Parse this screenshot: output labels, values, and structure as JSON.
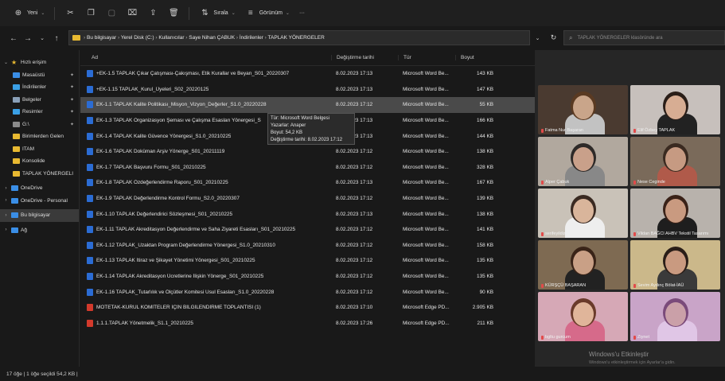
{
  "toolbar": {
    "new_label": "Yeni",
    "sort_label": "Sırala",
    "view_label": "Görünüm",
    "more_label": "···"
  },
  "address": {
    "breadcrumb": [
      "Bu bilgisayar",
      "Yerel Disk (C:)",
      "Kullanıcılar",
      "Saye Nihan ÇABUK",
      "İndirilenler",
      "TAPLAK YÖNERGELER"
    ],
    "search_placeholder": "TAPLAK YÖNERGELER klasöründe ara"
  },
  "sidebar": {
    "items": [
      {
        "label": "Hızlı erişim",
        "icon": "star-icon",
        "color": "#e8b931",
        "pinned": false
      },
      {
        "label": "Masaüstü",
        "icon": "desktop-icon",
        "color": "#3a8ee6",
        "pinned": true
      },
      {
        "label": "İndirilenler",
        "icon": "download-icon",
        "color": "#3aa0e6",
        "pinned": true
      },
      {
        "label": "Belgeler",
        "icon": "documents-icon",
        "color": "#8aa0b8",
        "pinned": true
      },
      {
        "label": "Resimler",
        "icon": "pictures-icon",
        "color": "#3aa0e6",
        "pinned": true
      },
      {
        "label": "G:\\",
        "icon": "drive-icon",
        "color": "#8a8a8a",
        "pinned": true
      },
      {
        "label": "Birimlerden Gelen",
        "icon": "folder-icon",
        "color": "#e8b931",
        "pinned": false
      },
      {
        "label": "ITAM",
        "icon": "folder-icon",
        "color": "#e8b931",
        "pinned": false
      },
      {
        "label": "Konsolide",
        "icon": "folder-icon",
        "color": "#e8b931",
        "pinned": false
      },
      {
        "label": "TAPLAK YÖNERGELI",
        "icon": "folder-icon",
        "color": "#e8b931",
        "pinned": false
      },
      {
        "label": "OneDrive",
        "icon": "cloud-icon",
        "color": "#3a8ee6",
        "pinned": false
      },
      {
        "label": "OneDrive - Personal",
        "icon": "cloud-icon",
        "color": "#3a8ee6",
        "pinned": false
      },
      {
        "label": "Bu bilgisayar",
        "icon": "computer-icon",
        "color": "#3a8ee6",
        "pinned": false
      },
      {
        "label": "Ağ",
        "icon": "network-icon",
        "color": "#3a8ee6",
        "pinned": false
      }
    ]
  },
  "columns": {
    "name": "Ad",
    "date": "Değiştirme tarihi",
    "type": "Tür",
    "size": "Boyut"
  },
  "files": [
    {
      "name": "+EK-1.5 TAPLAK Çıkar Çatışması-Çakışması, Etik Kurallar ve Beyan_S01_20220307",
      "date": "8.02.2023 17:13",
      "type": "Microsoft Word Be...",
      "size": "143 KB",
      "kind": "word"
    },
    {
      "name": "+EK-1.15 TAPLAK_Kurul_Üyeleri_S02_20220125",
      "date": "8.02.2023 17:13",
      "type": "Microsoft Word Be...",
      "size": "147 KB",
      "kind": "word"
    },
    {
      "name": "EK-1.1 TAPLAK Kalite Politikası_Misyon_Vizyon_Değerler_S1.0_20220228",
      "date": "8.02.2023 17:12",
      "type": "Microsoft Word Be...",
      "size": "55 KB",
      "kind": "word"
    },
    {
      "name": "EK-1.3 TAPLAK Organizasyon Şeması ve Çalışma Esasları Yönergesi_S",
      "date": "8.02.2023 17:13",
      "type": "Microsoft Word Be...",
      "size": "166 KB",
      "kind": "word"
    },
    {
      "name": "EK-1.4 TAPLAK Kalite Güvence Yönergesi_S1.0_20210225",
      "date": "8.02.2023 17:13",
      "type": "Microsoft Word Be...",
      "size": "144 KB",
      "kind": "word"
    },
    {
      "name": "EK-1.6 TAPLAK Doküman Arşiv Yönerge_S01_20211119",
      "date": "8.02.2023 17:12",
      "type": "Microsoft Word Be...",
      "size": "138 KB",
      "kind": "word"
    },
    {
      "name": "EK-1.7 TAPLAK Başvuru Formu_S01_20210225",
      "date": "8.02.2023 17:12",
      "type": "Microsoft Word Be...",
      "size": "328 KB",
      "kind": "word"
    },
    {
      "name": "EK-1.8 TAPLAK Özdeğerlendirme Raporu_S01_20210225",
      "date": "8.02.2023 17:13",
      "type": "Microsoft Word Be...",
      "size": "167 KB",
      "kind": "word"
    },
    {
      "name": "EK-1.9 TAPLAK Değerlendirme Kontrol Formu_S2.0_20220307",
      "date": "8.02.2023 17:12",
      "type": "Microsoft Word Be...",
      "size": "139 KB",
      "kind": "word"
    },
    {
      "name": "EK-1.10 TAPLAK Değerlendirici Sözleşmesi_S01_20210225",
      "date": "8.02.2023 17:13",
      "type": "Microsoft Word Be...",
      "size": "138 KB",
      "kind": "word"
    },
    {
      "name": "EK-1.11 TAPLAK Akreditasyon Değerlendirme ve Saha Ziyareti Esasları_S01_20210225",
      "date": "8.02.2023 17:12",
      "type": "Microsoft Word Be...",
      "size": "141 KB",
      "kind": "word"
    },
    {
      "name": "EK-1.12 TAPLAK_Uzaktan Program Değerlendirme Yönergesi_S1.0_20210310",
      "date": "8.02.2023 17:12",
      "type": "Microsoft Word Be...",
      "size": "158 KB",
      "kind": "word"
    },
    {
      "name": "EK-1.13 TAPLAK İtiraz ve Şikayet Yönetimi Yönergesi_S01_20210225",
      "date": "8.02.2023 17:12",
      "type": "Microsoft Word Be...",
      "size": "135 KB",
      "kind": "word"
    },
    {
      "name": "EK-1.14 TAPLAK Akreditasyon Ücretlerine İlişkin Yönerge_S01_20210225",
      "date": "8.02.2023 17:12",
      "type": "Microsoft Word Be...",
      "size": "135 KB",
      "kind": "word"
    },
    {
      "name": "EK-1.16 TAPLAK_Tutarlılık ve Ölçütler Komitesi Usul Esasları_S1.0_20220228",
      "date": "8.02.2023 17:12",
      "type": "Microsoft Word Be...",
      "size": "90 KB",
      "kind": "word"
    },
    {
      "name": "MOTETAK-KURUL KOMİTELER İÇİN BİLGİLENDİRME TOPLANTISI (1)",
      "date": "8.02.2023 17:10",
      "type": "Microsoft Edge PD...",
      "size": "2.905 KB",
      "kind": "pdf"
    },
    {
      "name": "1.1.1.TAPLAK Yönetmelik_S1.1_20210225",
      "date": "8.02.2023 17:26",
      "type": "Microsoft Edge PD...",
      "size": "211 KB",
      "kind": "pdf"
    }
  ],
  "tooltip": {
    "line1": "Tür: Microsoft Word Belgesi",
    "line2": "Yazarlar: Anaper",
    "line3": "Boyut: 54,2 KB",
    "line4": "Değiştirme tarihi: 8.02.2023 17:12"
  },
  "status": {
    "text": "17 öğe  |  1 öğe seçildi  54,2 KB  |"
  },
  "participants": [
    {
      "name": "Fatma Nur Başaran",
      "bg": "#4a3a30",
      "skin": "#c9a58a",
      "hair": "#5a3a22",
      "shirt": "#c2c2c2"
    },
    {
      "name": "Elif Özbey TAPLAK",
      "bg": "#c7c0bc",
      "skin": "#d7ad93",
      "hair": "#2a1e18",
      "shirt": "#222222"
    },
    {
      "name": "Alper Çabuk",
      "bg": "#b1a89e",
      "skin": "#c9a08a",
      "hair": "#2e2a28",
      "shirt": "#888888"
    },
    {
      "name": "Nese Ceginde",
      "bg": "#7a6a5a",
      "skin": "#c69a82",
      "hair": "#3a2a20",
      "shirt": "#b05a4a"
    },
    {
      "name": "serifeyildiz",
      "bg": "#c9c2b8",
      "skin": "#d9b59b",
      "hair": "#3a2a22",
      "shirt": "#eeeeee"
    },
    {
      "name": "Vildan BAĞCI AHBV Tekstil Tasarımı",
      "bg": "#b8b2ac",
      "skin": "#c99a80",
      "hair": "#3a2218",
      "shirt": "#1e1e1e"
    },
    {
      "name": "KÜRŞÇÜ BAŞARAN",
      "bg": "#7e6a52",
      "skin": "#c9a086",
      "hair": "#3a2418",
      "shirt": "#222222"
    },
    {
      "name": "Sevim Aydınç Bölat-İAÜ",
      "bg": "#cbb88a",
      "skin": "#c99a80",
      "hair": "#2a1e18",
      "shirt": "#3a3a3a"
    },
    {
      "name": "bgltu gurcum",
      "bg": "#d6a8b6",
      "skin": "#e0b59a",
      "hair": "#6a3a2a",
      "shirt": "#d66a8a"
    },
    {
      "name": "Ziynet",
      "bg": "#c9a4c8",
      "skin": "#caa0a8",
      "hair": "#7a4a7a",
      "shirt": "#e0c6e6"
    }
  ],
  "watermark": {
    "line1": "Windows'u Etkinleştir",
    "line2": "Windows'u etkinleştirmek için Ayarlar'a gidin."
  }
}
